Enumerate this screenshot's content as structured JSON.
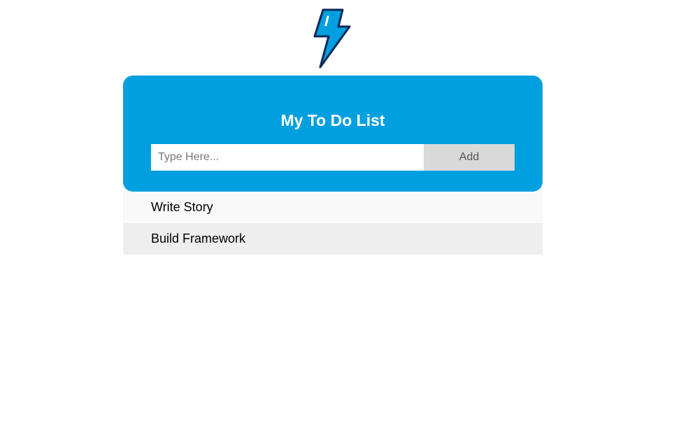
{
  "logo": {
    "icon": "lightning-bolt-icon",
    "fill": "#009fdf",
    "stroke": "#0a2a5a"
  },
  "header": {
    "title": "My To Do List",
    "accent": "#009fdf"
  },
  "form": {
    "input_value": "",
    "input_placeholder": "Type Here...",
    "add_label": "Add"
  },
  "tasks": [
    {
      "label": "Write Story"
    },
    {
      "label": "Build Framework"
    }
  ]
}
